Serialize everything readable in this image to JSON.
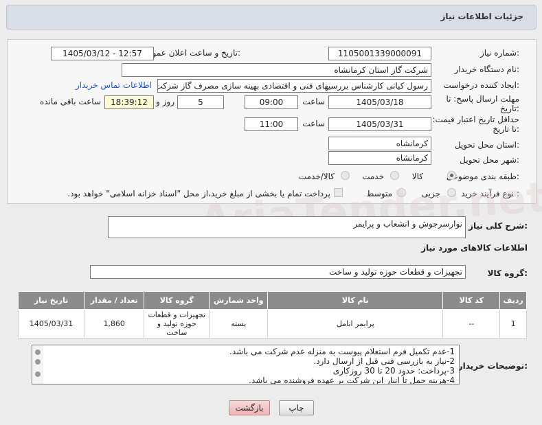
{
  "header": {
    "title": "جزئیات اطلاعات نیاز"
  },
  "form": {
    "need_number_label": "شماره نیاز:",
    "need_number": "1105001339000091",
    "announce_label": "تاریخ و ساعت اعلان عمومی:",
    "announce_value": "1405/03/12 - 12:57",
    "buyer_org_label": "نام دستگاه خریدار:",
    "buyer_org": "شرکت گاز استان کرمانشاه",
    "creator_label": "ایجاد کننده درخواست:",
    "creator": "رسول کیانی کارشناس بررسیهای فنی و اقتصادی بهینه سازی مصرف گاز شرکت",
    "contact_link": "اطلاعات تماس خریدار",
    "reply_deadline_label": "مهلت ارسال پاسخ: تا تاریخ:",
    "reply_date": "1405/03/18",
    "hour_label": "ساعت",
    "reply_time": "09:00",
    "days_value": "5",
    "days_label": "روز و",
    "remaining_value": "18:39:12",
    "remaining_label": "ساعت باقی مانده",
    "price_validity_label": "حداقل تاریخ اعتبار قیمت: تا تاریخ:",
    "price_date": "1405/03/31",
    "price_hour_label": "ساعت",
    "price_time": "11:00",
    "province_label": "استان محل تحویل:",
    "province": "کرمانشاه",
    "city_label": "شهر محل تحویل:",
    "city": "کرمانشاه",
    "category_label": "طبقه بندی موضوعی:",
    "category_options": [
      "کالا",
      "خدمت",
      "کالا/خدمت"
    ],
    "purchase_type_label": "نوع فرآیند خرید :",
    "purchase_options": [
      "جزیی",
      "متوسط"
    ],
    "payment_note": "پرداخت تمام یا بخشی از مبلغ خرید،از محل \"اسناد خزانه اسلامی\" خواهد بود."
  },
  "summary": {
    "label": "شرح کلی نیاز:",
    "value": "نوارسرجوش و انشعاب و پرایمر"
  },
  "goods_info_title": "اطلاعات کالاهای مورد نیاز",
  "goods_group": {
    "label": "گروه کالا:",
    "value": "تجهیزات و قطعات حوزه تولید و ساخت"
  },
  "table": {
    "headers": [
      "ردیف",
      "کد کالا",
      "نام کالا",
      "واحد شمارش",
      "گروه کالا",
      "تعداد / مقدار",
      "تاریخ نیاز"
    ],
    "rows": [
      [
        "1",
        "--",
        "پرایمر انامل",
        "بسته",
        "تجهیزات و قطعات حوزه تولید و ساخت",
        "1,860",
        "1405/03/31"
      ]
    ]
  },
  "notes": {
    "label": "توضیحات خریدار:",
    "lines": [
      "1-عدم تکمیل فرم استعلام پیوست به منزله عدم شرکت می باشد.",
      "2-نیاز به بازرسی فنی قبل از ارسال دارد.",
      "3-پرداخت: حدود 20 تا 30 روزکاری",
      "4-هزینه حمل  تا انبار این شرکت بر عهده فروشنده می باشد."
    ]
  },
  "buttons": {
    "print": "چاپ",
    "back": "بازگشت"
  },
  "watermark": "AriaTender.net"
}
